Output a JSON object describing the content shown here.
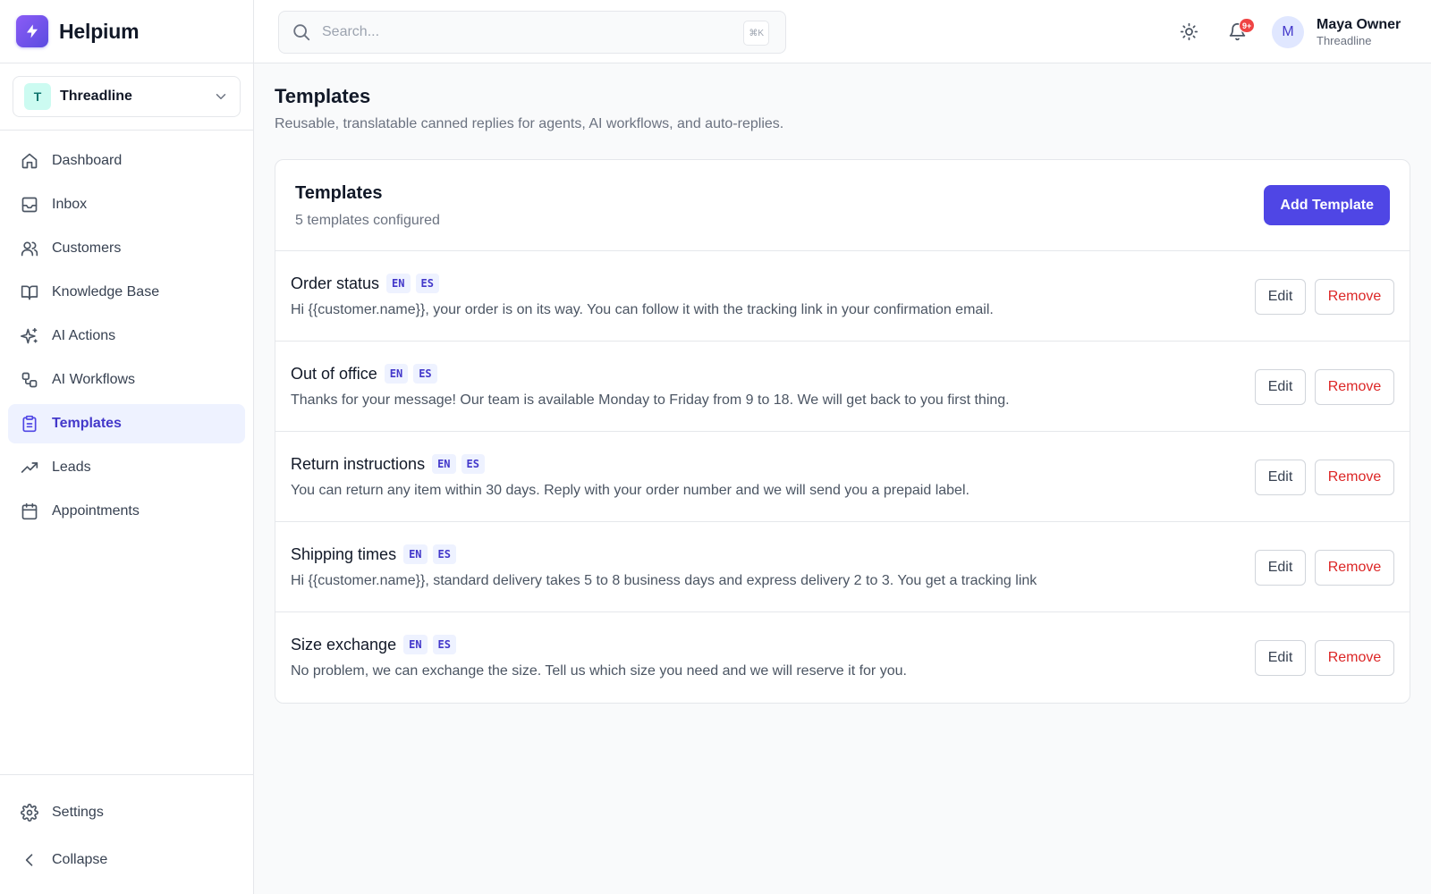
{
  "brand": {
    "name": "Helpium",
    "accent": "#4f46e5"
  },
  "workspace": {
    "initial": "T",
    "name": "Threadline"
  },
  "nav": {
    "items": [
      {
        "label": "Dashboard",
        "icon": "home-icon"
      },
      {
        "label": "Inbox",
        "icon": "inbox-icon"
      },
      {
        "label": "Customers",
        "icon": "users-icon"
      },
      {
        "label": "Knowledge Base",
        "icon": "book-icon"
      },
      {
        "label": "AI Actions",
        "icon": "sparkles-icon"
      },
      {
        "label": "AI Workflows",
        "icon": "workflow-icon"
      },
      {
        "label": "Templates",
        "icon": "clipboard-icon",
        "active": true
      },
      {
        "label": "Leads",
        "icon": "trending-up-icon"
      },
      {
        "label": "Appointments",
        "icon": "calendar-icon"
      }
    ],
    "settings_label": "Settings",
    "collapse_label": "Collapse"
  },
  "topbar": {
    "search_placeholder": "Search...",
    "shortcut": "⌘K",
    "notifications_badge": "9+",
    "user": {
      "initial": "M",
      "name": "Maya Owner",
      "org": "Threadline"
    }
  },
  "page": {
    "title": "Templates",
    "subtitle": "Reusable, translatable canned replies for agents, AI workflows, and auto-replies."
  },
  "card": {
    "title": "Templates",
    "count": "5 templates configured",
    "add_label": "Add Template",
    "edit_label": "Edit",
    "remove_label": "Remove"
  },
  "templates": [
    {
      "name": "Order status",
      "langs": [
        "EN",
        "ES"
      ],
      "body": "Hi {{customer.name}}, your order is on its way. You can follow it with the tracking link in your confirmation email."
    },
    {
      "name": "Out of office",
      "langs": [
        "EN",
        "ES"
      ],
      "body": "Thanks for your message! Our team is available Monday to Friday from 9 to 18. We will get back to you first thing."
    },
    {
      "name": "Return instructions",
      "langs": [
        "EN",
        "ES"
      ],
      "body": "You can return any item within 30 days. Reply with your order number and we will send you a prepaid label."
    },
    {
      "name": "Shipping times",
      "langs": [
        "EN",
        "ES"
      ],
      "body": "Hi {{customer.name}}, standard delivery takes 5 to 8 business days and express delivery 2 to 3. You get a tracking link"
    },
    {
      "name": "Size exchange",
      "langs": [
        "EN",
        "ES"
      ],
      "body": "No problem, we can exchange the size. Tell us which size you need and we will reserve it for you."
    }
  ]
}
